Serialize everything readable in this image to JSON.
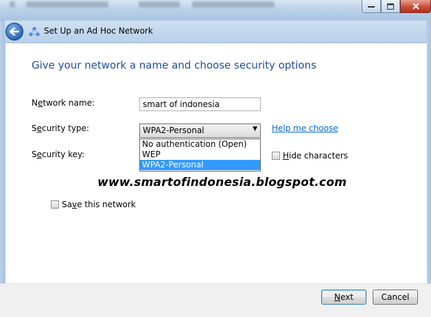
{
  "window": {
    "wizard_title": "Set Up an Ad Hoc Network"
  },
  "page": {
    "heading": "Give your network a name and choose security options",
    "network_name": {
      "label_pre": "N",
      "label_access": "e",
      "label_post": "twork name:",
      "value": "smart of indonesia"
    },
    "security_type": {
      "label_pre": "S",
      "label_access": "e",
      "label_post": "curity type:",
      "selected": "WPA2-Personal",
      "options": [
        "No authentication (Open)",
        "WEP",
        "WPA2-Personal"
      ],
      "help_link": "Help me choose"
    },
    "security_key": {
      "label_pre": "S",
      "label_access": "e",
      "label_post": "curity key:"
    },
    "hide_characters": {
      "label_access": "H",
      "label_post": "ide characters",
      "checked": false
    },
    "save_network": {
      "label_pre": "Sa",
      "label_access": "v",
      "label_post": "e this network",
      "checked": false
    },
    "watermark": "www.smartofindonesia.blogspot.com"
  },
  "footer": {
    "next": {
      "access": "N",
      "rest": "ext"
    },
    "cancel": "Cancel"
  },
  "colors": {
    "heading": "#1e4fa0",
    "link": "#0066cc",
    "selection": "#3399ff"
  }
}
